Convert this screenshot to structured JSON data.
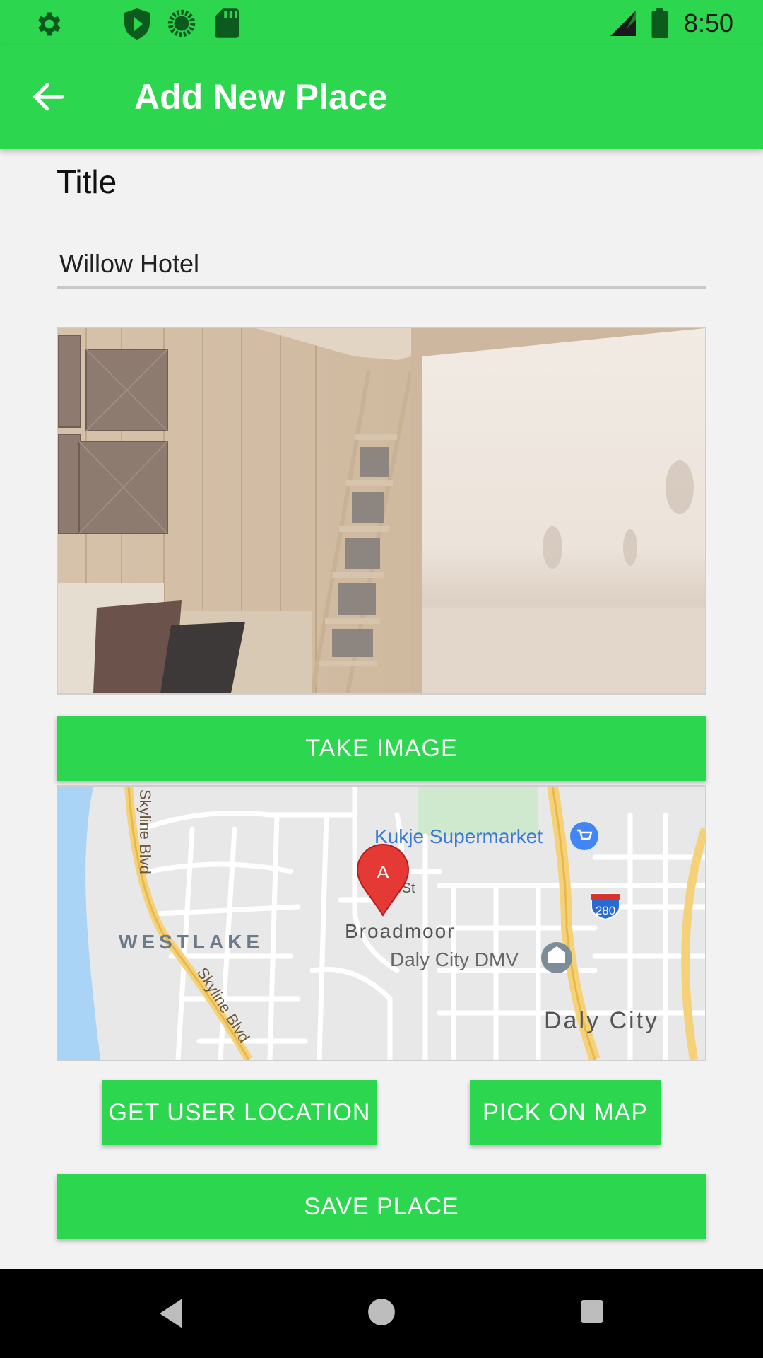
{
  "status_bar": {
    "time": "8:50",
    "icons": [
      "gear-icon",
      "shield-play-icon",
      "sync-icon",
      "sd-card-icon",
      "signal-icon",
      "battery-icon"
    ]
  },
  "app_bar": {
    "title": "Add New Place",
    "back_icon": "arrow-left-icon"
  },
  "form": {
    "title_label": "Title",
    "title_value": "Willow Hotel",
    "take_image_label": "TAKE IMAGE",
    "get_location_label": "GET USER LOCATION",
    "pick_on_map_label": "PICK ON MAP",
    "save_label": "SAVE PLACE"
  },
  "map": {
    "marker_label": "A",
    "places": {
      "kukje": "Kukje Supermarket",
      "broadmoor": "Broadmoor",
      "dmv": "Daly City DMV",
      "westlake": "WESTLAKE",
      "daly_city": "Daly City",
      "skyline1": "Skyline Blvd",
      "skyline2": "Skyline Blvd",
      "street": "n St",
      "highway": "280"
    }
  },
  "nav_bar": {
    "icons": [
      "back-triangle-icon",
      "home-circle-icon",
      "recents-square-icon"
    ]
  },
  "colors": {
    "accent": "#2dd64f",
    "background": "#f2f2f2",
    "nav": "#000000"
  }
}
